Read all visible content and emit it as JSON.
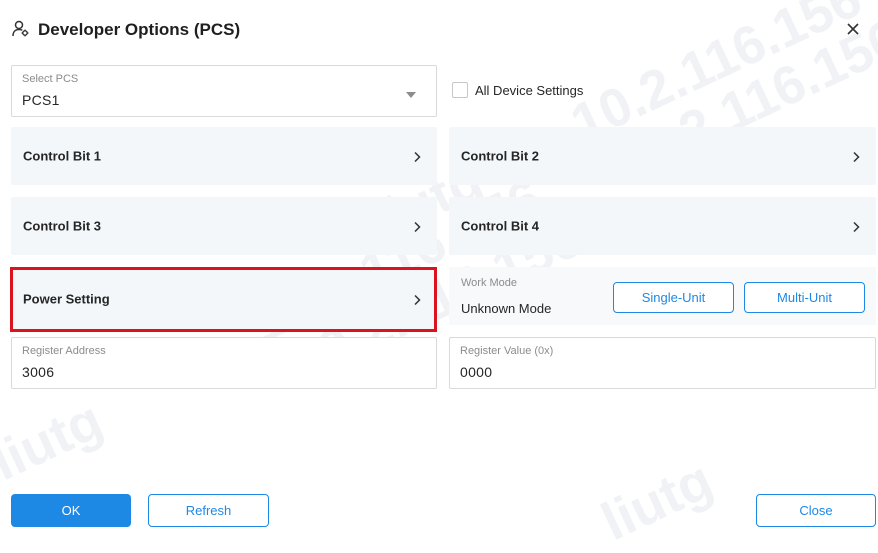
{
  "dialog": {
    "title": "Developer Options (PCS)",
    "title_icon": "user-settings-icon",
    "close_icon": "close-icon"
  },
  "select_pcs": {
    "label": "Select PCS",
    "value": "PCS1"
  },
  "all_device_settings": {
    "label": "All Device Settings",
    "checked": false
  },
  "panels": [
    {
      "label": "Control Bit 1"
    },
    {
      "label": "Control Bit 2"
    },
    {
      "label": "Control Bit 3"
    },
    {
      "label": "Control Bit 4"
    },
    {
      "label": "Power Setting",
      "highlighted": true
    }
  ],
  "work_mode": {
    "label": "Work Mode",
    "value": "Unknown Mode",
    "single_unit": "Single-Unit",
    "multi_unit": "Multi-Unit"
  },
  "register_address": {
    "label": "Register Address",
    "value": "3006"
  },
  "register_value": {
    "label": "Register Value (0x)",
    "value": "0000"
  },
  "footer": {
    "ok": "OK",
    "refresh": "Refresh",
    "close": "Close"
  },
  "colors": {
    "accent": "#1e88e5",
    "highlight": "#d9141e",
    "panel_bg": "#f3f7fa"
  },
  "watermark": {
    "lines": [
      "10.2.116.156",
      "liutg"
    ]
  }
}
